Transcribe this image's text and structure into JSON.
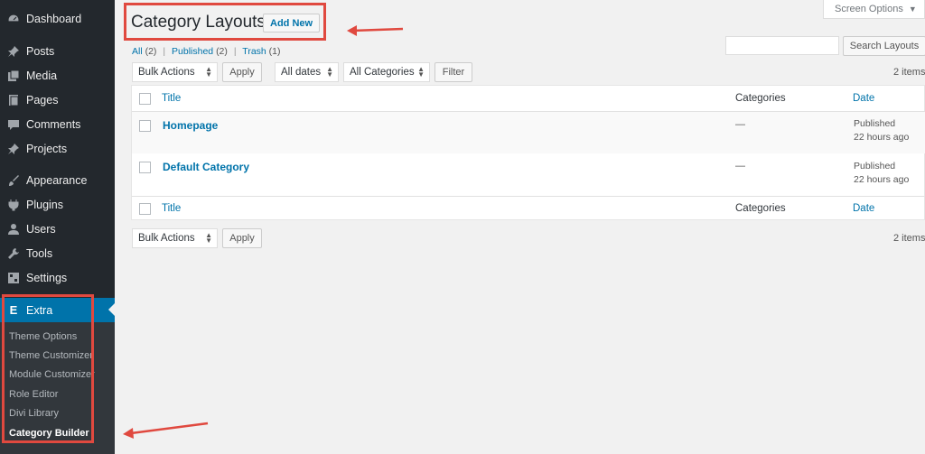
{
  "sidebar": {
    "items": [
      {
        "label": "Dashboard",
        "icon": "dashboard-icon"
      },
      {
        "label": "Posts",
        "icon": "pin-icon"
      },
      {
        "label": "Media",
        "icon": "media-icon"
      },
      {
        "label": "Pages",
        "icon": "pages-icon"
      },
      {
        "label": "Comments",
        "icon": "comment-icon"
      },
      {
        "label": "Projects",
        "icon": "pin-icon"
      },
      {
        "label": "Appearance",
        "icon": "brush-icon"
      },
      {
        "label": "Plugins",
        "icon": "plug-icon"
      },
      {
        "label": "Users",
        "icon": "user-icon"
      },
      {
        "label": "Tools",
        "icon": "wrench-icon"
      },
      {
        "label": "Settings",
        "icon": "settings-icon"
      }
    ],
    "active": {
      "label": "Extra",
      "icon": "extra-icon"
    },
    "submenu": [
      {
        "label": "Theme Options"
      },
      {
        "label": "Theme Customizer"
      },
      {
        "label": "Module Customizer"
      },
      {
        "label": "Role Editor"
      },
      {
        "label": "Divi Library"
      },
      {
        "label": "Category Builder"
      }
    ]
  },
  "header": {
    "title": "Category Layouts",
    "add_new": "Add New",
    "screen_options": "Screen Options"
  },
  "views": {
    "all": "All",
    "all_count": "(2)",
    "published": "Published",
    "published_count": "(2)",
    "trash": "Trash",
    "trash_count": "(1)"
  },
  "search": {
    "button": "Search Layouts"
  },
  "tablenav_top": {
    "bulk_actions": "Bulk Actions",
    "apply": "Apply",
    "dates": "All dates",
    "categories": "All Categories",
    "filter": "Filter",
    "count": "2 items"
  },
  "table": {
    "columns": {
      "title": "Title",
      "categories": "Categories",
      "date": "Date"
    },
    "rows": [
      {
        "title": "Homepage",
        "categories": "—",
        "status": "Published",
        "date": "22 hours ago"
      },
      {
        "title": "Default Category",
        "categories": "—",
        "status": "Published",
        "date": "22 hours ago"
      }
    ]
  },
  "tablenav_bottom": {
    "bulk_actions": "Bulk Actions",
    "apply": "Apply",
    "count": "2 items"
  },
  "colors": {
    "sidebar": "#23282d",
    "submenu": "#32373c",
    "accent": "#0073aa",
    "annotation": "#e0493f"
  }
}
